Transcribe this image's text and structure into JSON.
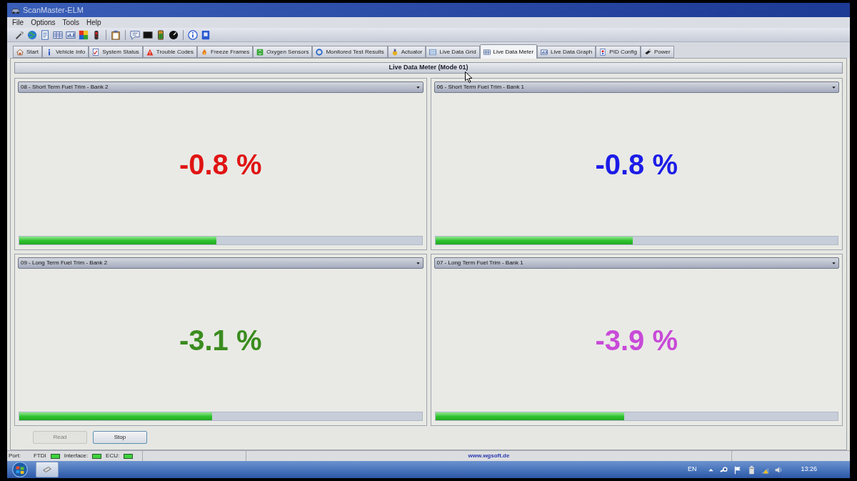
{
  "window": {
    "title": "ScanMaster-ELM"
  },
  "menu": [
    "File",
    "Options",
    "Tools",
    "Help"
  ],
  "tabs": [
    {
      "label": "Start",
      "selected": false
    },
    {
      "label": "Vehicle Info",
      "selected": false
    },
    {
      "label": "System Status",
      "selected": false
    },
    {
      "label": "Trouble Codes",
      "selected": false
    },
    {
      "label": "Freeze Frames",
      "selected": false
    },
    {
      "label": "Oxygen Sensors",
      "selected": false
    },
    {
      "label": "Monitored Test Results",
      "selected": false
    },
    {
      "label": "Actuator",
      "selected": false
    },
    {
      "label": "Live Data Grid",
      "selected": false
    },
    {
      "label": "Live Data Meter",
      "selected": true
    },
    {
      "label": "Live Data Graph",
      "selected": false
    },
    {
      "label": "PID Config",
      "selected": false
    },
    {
      "label": "Power",
      "selected": false
    }
  ],
  "panel": {
    "title": "Live Data Meter (Mode 01)"
  },
  "gauges": [
    {
      "pid": "08 - Short Term Fuel Trim - Bank 2",
      "reading": "-0.8 %",
      "color": "#e01414",
      "level": 0.49
    },
    {
      "pid": "06 - Short Term Fuel Trim - Bank 1",
      "reading": "-0.8 %",
      "color": "#1c1ce8",
      "level": 0.49
    },
    {
      "pid": "09 - Long Term Fuel Trim - Bank 2",
      "reading": "-3.1 %",
      "color": "#3a8c1e",
      "level": 0.48
    },
    {
      "pid": "07 - Long Term Fuel Trim - Bank 1",
      "reading": "-3.9 %",
      "color": "#c84ad8",
      "level": 0.47
    }
  ],
  "buttons": [
    {
      "label": "Read",
      "disabled": true
    },
    {
      "label": "Stop",
      "disabled": false
    }
  ],
  "status_bar": {
    "port_label": "Port:",
    "indicators": [
      {
        "label": "FTDI",
        "on": true
      },
      {
        "label": "Interface:",
        "on": true
      },
      {
        "label": "ECU:",
        "on": true
      }
    ],
    "website": "www.wgsoft.de"
  },
  "taskbar": {
    "language": "EN",
    "clock": "13:26"
  }
}
